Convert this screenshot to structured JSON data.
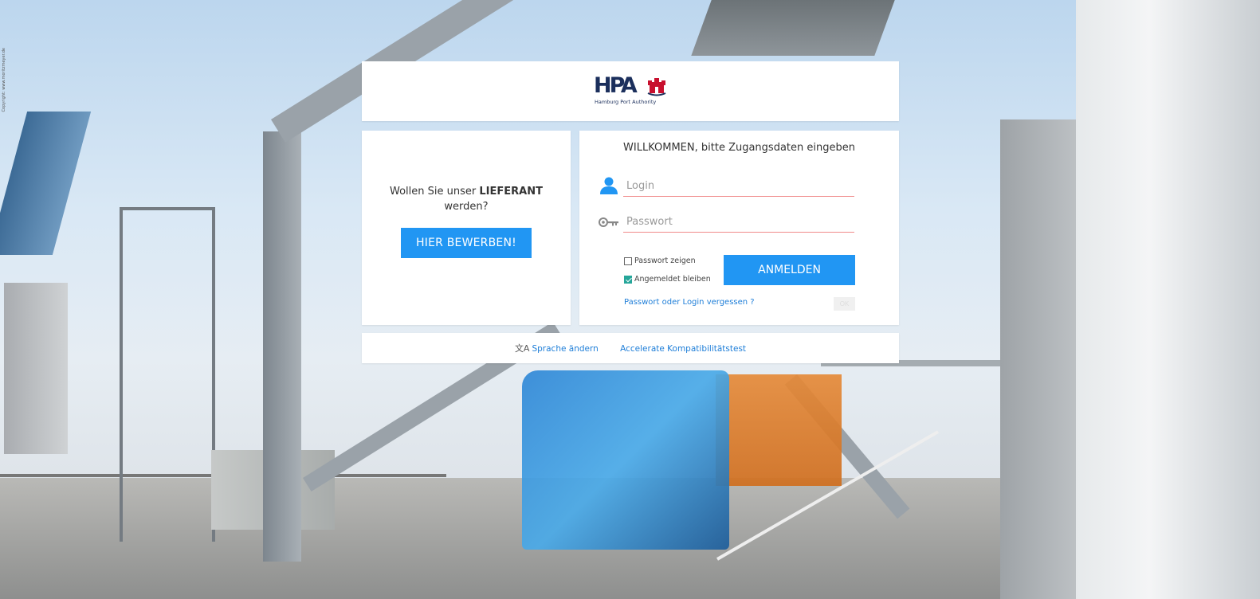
{
  "background": {
    "copyright": "Copyright: www.moritzmeyer.de"
  },
  "logo": {
    "mark": "HPA",
    "subtitle": "Hamburg Port Authority",
    "brand_color": "#1b2f5c"
  },
  "supplier": {
    "question_prefix": "Wollen Sie unser ",
    "question_emphasis": "LIEFERANT",
    "question_suffix": " werden?",
    "apply_label": "HIER BEWERBEN!"
  },
  "login": {
    "welcome_emphasis": "WILLKOMMEN,",
    "welcome_rest": " bitte Zugangsdaten eingeben",
    "login_placeholder": "Login",
    "login_value": "",
    "password_placeholder": "Passwort",
    "password_value": "",
    "show_password_label": "Passwort zeigen",
    "show_password_checked": false,
    "stay_logged_in_label": "Angemeldet bleiben",
    "stay_logged_in_checked": true,
    "submit_label": "ANMELDEN",
    "forgot_label": "Passwort oder Login vergessen ?",
    "ok_label": "OK",
    "user_icon": "user-icon",
    "key_icon": "key-icon"
  },
  "footer": {
    "language_icon": "translate-icon",
    "language_label": "Sprache ändern",
    "compat_label": "Accelerate Kompatibilitätstest"
  },
  "colors": {
    "accent": "#2196f3",
    "link": "#1e7ed8",
    "field_underline": "#f08a8a",
    "check_green": "#26a69a"
  }
}
